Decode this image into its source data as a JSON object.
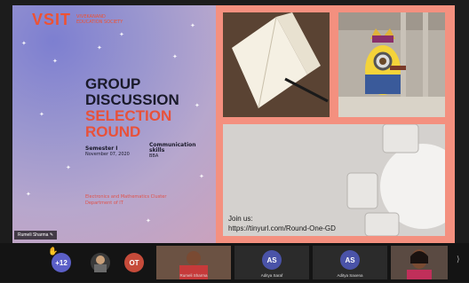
{
  "slide": {
    "logo": "VSIT",
    "logo_sub": "VIVEKANAND EDUCATION SOCIETY",
    "title_lines": [
      "GROUP",
      "DISCUSSION",
      "SELECTION",
      "ROUND"
    ],
    "semester": "Semester I",
    "date": "November 07, 2020",
    "communication": "Communication skills",
    "program": "BBA",
    "department": "Electronics and Mathematics Cluster Department of IT",
    "join_label": "Join us:",
    "join_url": "https://tinyurl.com/Round-One-GD"
  },
  "presenter_tag": "Rumeli Sharma",
  "participants": [
    {
      "label": "+12",
      "color": "#5b5fc7"
    },
    {
      "label": "",
      "color": "#3a3a3a"
    },
    {
      "label": "OT",
      "color": "#c64b3a"
    },
    {
      "name": "Rumeli Sharma"
    },
    {
      "label": "AS",
      "color": "#4a53a8",
      "name": "Aditya Saraf"
    },
    {
      "label": "AS",
      "color": "#4a53a8",
      "name": "Aditya Saxena"
    },
    {
      "name": ""
    }
  ],
  "colors": {
    "accent": "#ee5233",
    "salmon": "#f4907f",
    "teams": "#5b5fc7"
  }
}
